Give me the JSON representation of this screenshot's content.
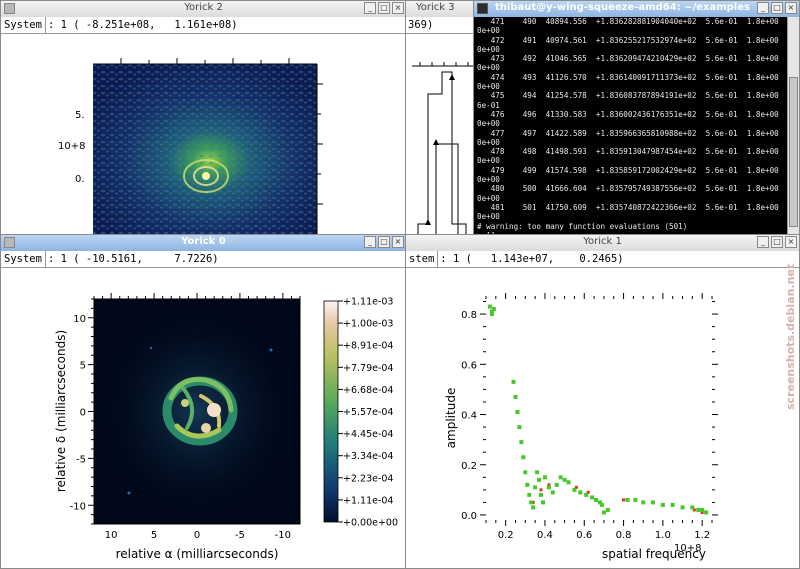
{
  "windows": {
    "yorick2": {
      "title": "Yorick 2",
      "system_label": "System",
      "coords": ": 1 ( -8.251e+08,   1.161e+08)",
      "y_ticks": [
        "5.",
        "0."
      ],
      "exponent_label": "10+8"
    },
    "yorick3": {
      "title": "Yorick 3",
      "coords": "369)"
    },
    "terminal": {
      "title": "thibaut@y-wing-squeeze-amd64: ~/examples",
      "lines": [
        "   471    490  40894.556  +1.836282881904040e+02  5.6e-01  1.8e+00  3.143e+02  1.",
        "0e+00",
        "   472    491  40974.561  +1.836255217532974e+02  5.6e-01  1.8e+00  2.670e+02  1.",
        "0e+00",
        "   473    492  41046.565  +1.836209474210429e+02  5.6e-01  1.8e+00  3.854e+02  1.",
        "0e+00",
        "   474    493  41126.570  +1.836140091711373e+02  5.6e-01  1.8e+00  4.371e+02  1.",
        "0e+00",
        "   475    494  41254.578  +1.836083787894191e+02  5.6e-01  1.8e+00  7.051e+02  4.",
        "6e-01",
        "   476    496  41330.583  +1.836002436176351e+02  5.6e-01  1.8e+00  3.313e+02  1.",
        "0e+00",
        "   477    497  41422.589  +1.835966365810988e+02  5.6e-01  1.8e+00  2.832e+02  1.",
        "0e+00",
        "   478    498  41498.593  +1.835913047987454e+02  5.6e-01  1.8e+00  4.775e+02  1.",
        "0e+00",
        "   479    499  41574.598  +1.835859172002429e+02  5.6e-01  1.8e+00  3.661e+02  1.",
        "0e+00",
        "   480    500  41666.604  +1.835795749387556e+02  5.6e-01  1.8e+00  4.840e+02  1.",
        "0e+00",
        "   481    501  41750.609  +1.835740872422366e+02  5.6e-01  1.8e+00  4.300e+02  1.",
        "0e+00",
        "# warning: too many function evaluations (501)",
        "> []"
      ]
    },
    "yorick0": {
      "title": "Yorick 0",
      "system_label": "System",
      "coords": ": 1 ( -10.5161,     7.7226)",
      "xlabel": "relative α (milliarcseconds)",
      "ylabel": "relative δ (milliarcseconds)",
      "x_ticks": [
        "10",
        "5",
        "0",
        "-5",
        "-10"
      ],
      "y_ticks": [
        "10",
        "5",
        "0",
        "-5",
        "-10"
      ],
      "colorbar_ticks": [
        "+1.11e-03",
        "+1.00e-03",
        "+8.91e-04",
        "+7.79e-04",
        "+6.68e-04",
        "+5.57e-04",
        "+4.45e-04",
        "+3.34e-04",
        "+2.23e-04",
        "+1.11e-04",
        "+0.00e+00"
      ]
    },
    "yorick1": {
      "title": "Yorick 1",
      "system_label": "stem",
      "coords": ": 1 (   1.143e+07,    0.2465)",
      "xlabel": "spatial frequency",
      "ylabel": "amplitude",
      "x_ticks": [
        "0.2",
        "0.4",
        "0.6",
        "0.8",
        "1.0",
        "1.2"
      ],
      "y_ticks": [
        "0.8",
        "0.6",
        "0.4",
        "0.2",
        "0.0"
      ],
      "exponent_label": "10+8",
      "model_color": "#e0301e",
      "data_color": "#46c82a"
    }
  },
  "watermark": "screenshots.debian.net",
  "chart_data": [
    {
      "type": "heatmap",
      "title": "",
      "xlabel": "relative α (milliarcseconds)",
      "ylabel": "relative δ (milliarcseconds)",
      "xlim": [
        12,
        -12
      ],
      "ylim": [
        -12,
        12
      ],
      "colorbar_range": [
        0.0,
        0.00111
      ],
      "features": "bright ring of blobs centred near (0,0), radius about 4 mas"
    },
    {
      "type": "scatter",
      "title": "",
      "xlabel": "spatial frequency",
      "ylabel": "amplitude",
      "x_unit_exponent": "10+8",
      "xlim": [
        0.1,
        1.25
      ],
      "ylim": [
        -0.02,
        0.86
      ],
      "series": [
        {
          "x": [
            0.12,
            0.13,
            0.13,
            0.14,
            0.24,
            0.25,
            0.26,
            0.27,
            0.28,
            0.29,
            0.3,
            0.31,
            0.32,
            0.33,
            0.34,
            0.35,
            0.36,
            0.37,
            0.38,
            0.39,
            0.4,
            0.42,
            0.44,
            0.46,
            0.48,
            0.5,
            0.52,
            0.55,
            0.58,
            0.61,
            0.64,
            0.66,
            0.68,
            0.69,
            0.7,
            0.72,
            0.82,
            0.86,
            0.9,
            0.95,
            1.0,
            1.05,
            1.1,
            1.15,
            1.18,
            1.2,
            1.22
          ],
          "y": [
            0.83,
            0.81,
            0.8,
            0.82,
            0.53,
            0.47,
            0.41,
            0.35,
            0.29,
            0.23,
            0.17,
            0.12,
            0.08,
            0.05,
            0.03,
            0.11,
            0.17,
            0.14,
            0.08,
            0.05,
            0.15,
            0.11,
            0.09,
            0.12,
            0.15,
            0.14,
            0.13,
            0.1,
            0.09,
            0.08,
            0.07,
            0.06,
            0.05,
            0.04,
            0.01,
            0.02,
            0.06,
            0.06,
            0.05,
            0.05,
            0.04,
            0.04,
            0.03,
            0.03,
            0.02,
            0.02,
            0.01
          ]
        },
        {
          "x": [
            0.13,
            0.34,
            0.38,
            0.42,
            0.5,
            0.56,
            0.62,
            0.68,
            0.8,
            0.9,
            1.0,
            1.1,
            1.16,
            1.2
          ],
          "y": [
            0.81,
            0.05,
            0.1,
            0.12,
            0.14,
            0.11,
            0.09,
            0.05,
            0.06,
            0.05,
            0.04,
            0.03,
            0.02,
            0.01
          ]
        }
      ]
    }
  ]
}
